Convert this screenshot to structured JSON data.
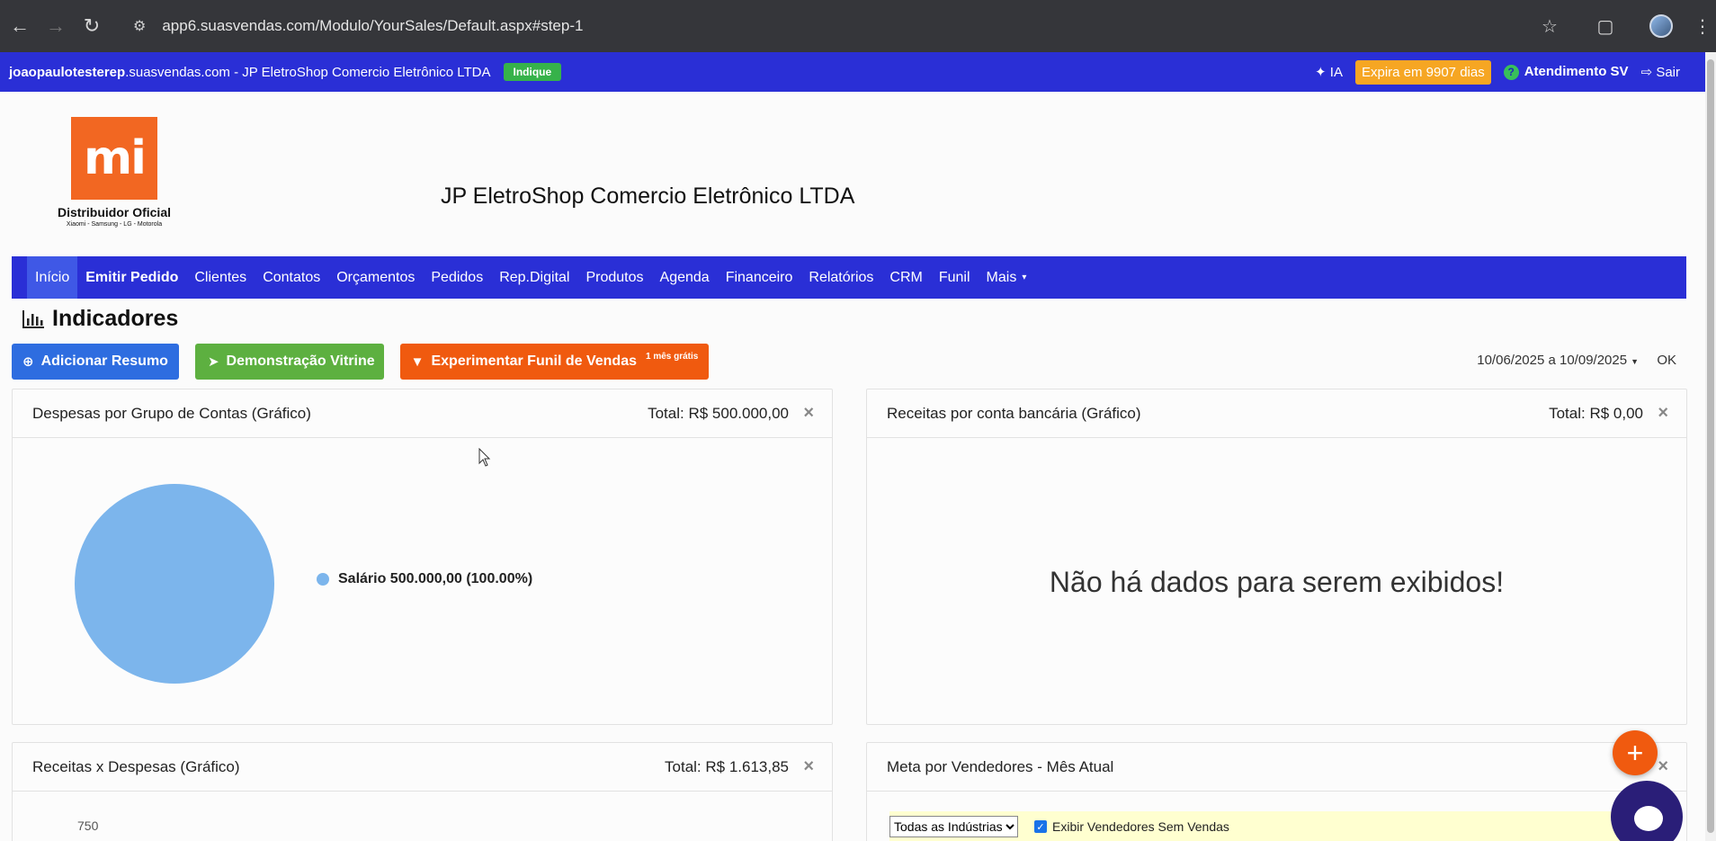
{
  "browser": {
    "url": "app6.suasvendas.com/Modulo/YourSales/Default.aspx#step-1"
  },
  "topbar": {
    "subdomain_bold": "joaopaulotesterep",
    "subdomain_rest": ".suasvendas.com - JP EletroShop Comercio Eletrônico LTDA",
    "indique": "Indique",
    "ia": "IA",
    "expira": "Expira em 9907 dias",
    "atendimento": "Atendimento SV",
    "sair": "Sair"
  },
  "logo": {
    "mark": "mi",
    "line1": "Distribuidor Oficial",
    "line2": "Xiaomi - Samsung - LG - Motorola"
  },
  "company_name": "JP EletroShop Comercio Eletrônico LTDA",
  "menu": [
    {
      "label": "Início",
      "active": true
    },
    {
      "label": "Emitir Pedido",
      "bold": true
    },
    {
      "label": "Clientes"
    },
    {
      "label": "Contatos"
    },
    {
      "label": "Orçamentos"
    },
    {
      "label": "Pedidos"
    },
    {
      "label": "Rep.Digital"
    },
    {
      "label": "Produtos"
    },
    {
      "label": "Agenda"
    },
    {
      "label": "Financeiro"
    },
    {
      "label": "Relatórios"
    },
    {
      "label": "CRM"
    },
    {
      "label": "Funil"
    },
    {
      "label": "Mais"
    }
  ],
  "indicadores": {
    "title": "Indicadores",
    "add_resumo": "Adicionar Resumo",
    "demo_vitrine": "Demonstração Vitrine",
    "funil": "Experimentar Funil de Vendas",
    "funil_badge": "1 mês grátis",
    "date_range": "10/06/2025 a 10/09/2025",
    "ok": "OK"
  },
  "panels": {
    "despesas": {
      "title": "Despesas por Grupo de Contas (Gráfico)",
      "total": "Total: R$ 500.000,00",
      "legend": "Salário 500.000,00 (100.00%)"
    },
    "receitas_conta": {
      "title": "Receitas por conta bancária (Gráfico)",
      "total": "Total: R$ 0,00",
      "nodata": "Não há dados para serem exibidos!"
    },
    "receitas_despesas": {
      "title": "Receitas x Despesas (Gráfico)",
      "total": "Total: R$ 1.613,85",
      "ytick": "750"
    },
    "meta": {
      "title": "Meta por Vendedores - Mês Atual",
      "select_value": "Todas as Indústrias",
      "checkbox_label": "Exibir Vendedores Sem Vendas"
    }
  },
  "colors": {
    "brand_blue": "#2a2fd6",
    "orange": "#f05a0f",
    "pie": "#7cb5ec"
  },
  "chart_data": {
    "type": "pie",
    "categories": [
      "Salário"
    ],
    "values": [
      500000
    ],
    "labels": [
      "Salário 500.000,00 (100.00%)"
    ],
    "legend": "right"
  }
}
